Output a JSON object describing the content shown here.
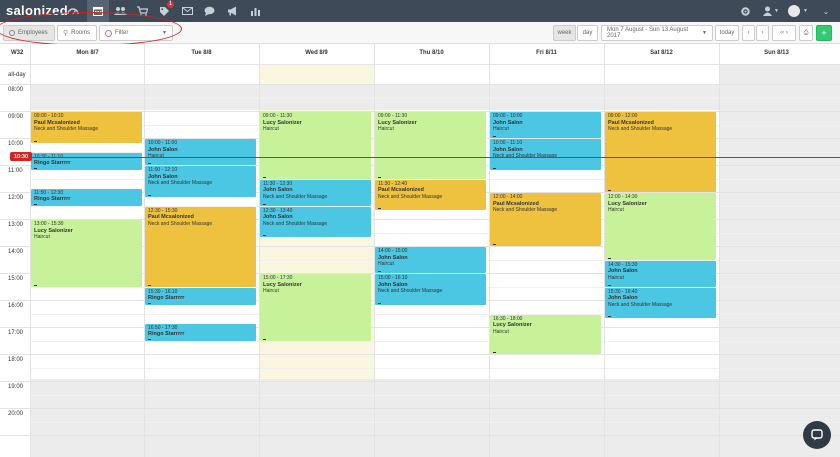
{
  "app": {
    "logo": "salonized"
  },
  "nav": {
    "icons": [
      "dashboard-icon",
      "calendar-icon",
      "customers-icon",
      "cart-icon",
      "tag-icon",
      "mail-icon",
      "chat-bubble-icon",
      "megaphone-icon",
      "reports-icon"
    ],
    "badge_count": "1",
    "right_icons": [
      "settings-icon",
      "user-icon",
      "avatar"
    ]
  },
  "toolbar": {
    "employees_label": "Employees",
    "rooms_label": "Rooms",
    "filter_label": "Filter",
    "week_label": "week",
    "day_label": "day",
    "date_range": "Mon 7 August - Sun 13 August 2017",
    "today_label": "today",
    "prev": "‹",
    "next": "›",
    "more": "‹‹ ›",
    "print": "⎙",
    "add": "+"
  },
  "calendar": {
    "week_label": "W32",
    "allday_label": "all-day",
    "days": [
      "Mon 8/7",
      "Tue 8/8",
      "Wed 8/9",
      "Thu 8/10",
      "Fri 8/11",
      "Sat 8/12",
      "Sun 8/13"
    ],
    "hours": [
      "08:00",
      "09:00",
      "10:00",
      "11:00",
      "12:00",
      "13:00",
      "14:00",
      "15:00",
      "16:00",
      "17:00",
      "18:00",
      "19:00",
      "20:00"
    ],
    "now_label": "10:30",
    "events": [
      {
        "day": 0,
        "start": "09:00",
        "end": "10:10",
        "time": "09:00 - 10:10",
        "name": "Paul Mcsalonized",
        "service": "Neck and Shoulder Massage",
        "color": "yellow"
      },
      {
        "day": 0,
        "start": "10:30",
        "end": "11:10",
        "time": "10:30 - 11:10",
        "name": "Ringo Starrrrr",
        "service": "",
        "color": "blue"
      },
      {
        "day": 0,
        "start": "11:50",
        "end": "12:30",
        "time": "11:50 - 12:30",
        "name": "Ringo Starrrrr",
        "service": "",
        "color": "blue"
      },
      {
        "day": 0,
        "start": "13:00",
        "end": "15:30",
        "time": "13:00 - 15:30",
        "name": "Lucy Salonizer",
        "service": "Haircut",
        "color": "green"
      },
      {
        "day": 1,
        "start": "10:00",
        "end": "11:00",
        "time": "10:00 - 11:00",
        "name": "John Salon",
        "service": "Haircut",
        "color": "blue"
      },
      {
        "day": 1,
        "start": "11:00",
        "end": "12:10",
        "time": "11:00 - 12:10",
        "name": "John Salon",
        "service": "Neck and Shoulder Massage",
        "color": "blue"
      },
      {
        "day": 1,
        "start": "12:30",
        "end": "15:30",
        "time": "12:30 - 15:30",
        "name": "Paul Mcsalonized",
        "service": "Neck and Shoulder Massage",
        "color": "yellow"
      },
      {
        "day": 1,
        "start": "15:30",
        "end": "16:10",
        "time": "15:30 - 16:10",
        "name": "Ringo Starrrrr",
        "service": "",
        "color": "blue"
      },
      {
        "day": 1,
        "start": "16:50",
        "end": "17:30",
        "time": "16:50 - 17:30",
        "name": "Ringo Starrrrr",
        "service": "",
        "color": "blue"
      },
      {
        "day": 2,
        "start": "09:00",
        "end": "11:30",
        "time": "09:00 - 11:30",
        "name": "Lucy Salonizer",
        "service": "Haircut",
        "color": "green"
      },
      {
        "day": 2,
        "start": "11:30",
        "end": "12:30",
        "time": "11:30 - 12:30",
        "name": "John Salon",
        "service": "Neck and Shoulder Massage",
        "color": "blue"
      },
      {
        "day": 2,
        "start": "12:30",
        "end": "13:40",
        "time": "12:30 - 13:40",
        "name": "John Salon",
        "service": "Neck and Shoulder Massage",
        "color": "blue"
      },
      {
        "day": 2,
        "start": "15:00",
        "end": "17:30",
        "time": "15:00 - 17:30",
        "name": "Lucy Salonizer",
        "service": "Haircut",
        "color": "green"
      },
      {
        "day": 3,
        "start": "09:00",
        "end": "11:30",
        "time": "09:00 - 11:30",
        "name": "Lucy Salonizer",
        "service": "Haircut",
        "color": "green"
      },
      {
        "day": 3,
        "start": "11:30",
        "end": "12:40",
        "time": "11:30 - 12:40",
        "name": "Paul Mcsalonized",
        "service": "Neck and Shoulder Massage",
        "color": "yellow"
      },
      {
        "day": 3,
        "start": "14:00",
        "end": "15:00",
        "time": "14:00 - 15:00",
        "name": "John Salon",
        "service": "Haircut",
        "color": "blue"
      },
      {
        "day": 3,
        "start": "15:00",
        "end": "16:10",
        "time": "15:00 - 16:10",
        "name": "John Salon",
        "service": "Neck and Shoulder Massage",
        "color": "blue"
      },
      {
        "day": 4,
        "start": "09:00",
        "end": "10:00",
        "time": "09:00 - 10:00",
        "name": "John Salon",
        "service": "Haircut",
        "color": "blue"
      },
      {
        "day": 4,
        "start": "10:00",
        "end": "11:10",
        "time": "10:00 - 11:10",
        "name": "John Salon",
        "service": "Neck and Shoulder Massage",
        "color": "blue"
      },
      {
        "day": 4,
        "start": "12:00",
        "end": "14:00",
        "time": "12:00 - 14:00",
        "name": "Paul Mcsalonized",
        "service": "Neck and Shoulder Massage",
        "color": "yellow"
      },
      {
        "day": 4,
        "start": "16:30",
        "end": "18:00",
        "time": "16:30 - 18:00",
        "name": "Lucy Salonizer",
        "service": "Haircut",
        "color": "green"
      },
      {
        "day": 5,
        "start": "09:00",
        "end": "12:00",
        "time": "09:00 - 12:00",
        "name": "Paul Mcsalonized",
        "service": "Neck and Shoulder Massage",
        "color": "yellow"
      },
      {
        "day": 5,
        "start": "12:00",
        "end": "14:30",
        "time": "12:00 - 14:30",
        "name": "Lucy Salonizer",
        "service": "Haircut",
        "color": "green"
      },
      {
        "day": 5,
        "start": "14:30",
        "end": "15:30",
        "time": "14:30 - 15:30",
        "name": "John Salon",
        "service": "Haircut",
        "color": "blue"
      },
      {
        "day": 5,
        "start": "15:30",
        "end": "16:40",
        "time": "15:30 - 16:40",
        "name": "John Salon",
        "service": "Neck and Shoulder Massage",
        "color": "blue"
      }
    ]
  },
  "colors": {
    "nav_bg": "#3e4a57",
    "yellow": "#eec23e",
    "blue": "#4bc6e3",
    "green": "#c8f29a",
    "now": "#dd2222",
    "add_button": "#2ecc71"
  }
}
